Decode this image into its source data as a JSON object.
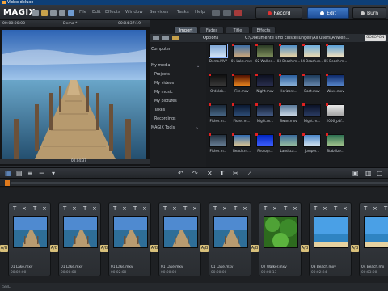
{
  "window": {
    "title": "Video deluxe"
  },
  "app": {
    "logo": "MAGIX"
  },
  "menu": [
    "File",
    "Edit",
    "Effects",
    "Window",
    "Services",
    "Tasks",
    "Help"
  ],
  "modes": {
    "record": "Record",
    "edit": "Edit",
    "burn": "Burn"
  },
  "monitor": {
    "time_left": "00:00:00:00",
    "title": "Demo *",
    "time_right": "00:04:37:19",
    "position_marker": "00:04:37"
  },
  "media_pool": {
    "tabs": [
      "Import",
      "Fades",
      "Title",
      "Effects"
    ],
    "options_label": "Options",
    "path": "C:\\Dokumente und Einstellungen\\All Users\\Anwen...",
    "brand": "GOKOPON",
    "tree": [
      "Computer",
      "My media",
      "Projects",
      "My videos",
      "My music",
      "My pictures",
      "Takes",
      "Recordings",
      "MAGIX Tools"
    ],
    "files": [
      {
        "name": "Demo.MVP"
      },
      {
        "name": "01 Lake.mxv"
      },
      {
        "name": "02 Walker..."
      },
      {
        "name": "03 Beach.m..."
      },
      {
        "name": "04 Beach.m..."
      },
      {
        "name": "05 Beach.m..."
      },
      {
        "name": "Ordolok..."
      },
      {
        "name": "Fire.mxv"
      },
      {
        "name": "Night.mxv"
      },
      {
        "name": "Horizont..."
      },
      {
        "name": "Boat.mxv"
      },
      {
        "name": "Wave.mxv"
      },
      {
        "name": "Fisher.m..."
      },
      {
        "name": "Fisher.m..."
      },
      {
        "name": "Night.m..."
      },
      {
        "name": "Swan.mxv"
      },
      {
        "name": "Night.m..."
      },
      {
        "name": "2006_pdf..."
      },
      {
        "name": "Fisher.m..."
      },
      {
        "name": "Beach.m..."
      },
      {
        "name": "Photogr..."
      },
      {
        "name": "Landsca..."
      },
      {
        "name": "Jumper..."
      },
      {
        "name": "Stabilize..."
      }
    ]
  },
  "timeline": {
    "clips": [
      {
        "name": "01 Lake.mxv",
        "duration": "00:02:00"
      },
      {
        "name": "01 Lake.mxv",
        "duration": "00:00:00"
      },
      {
        "name": "01 Lake.mxv",
        "duration": "00:02:00"
      },
      {
        "name": "01 Lake.mxv",
        "duration": "00:00:00"
      },
      {
        "name": "01 Lake.mxv",
        "duration": "00:00:00"
      },
      {
        "name": "02 Walker.mxv",
        "duration": "00:00:13"
      },
      {
        "name": "03 Beach.mxv",
        "duration": "00:02:24"
      },
      {
        "name": "04 Beach.mx",
        "duration": "00:03:00"
      }
    ],
    "transition_label": "A/B"
  },
  "status": {
    "text": "SNL"
  }
}
